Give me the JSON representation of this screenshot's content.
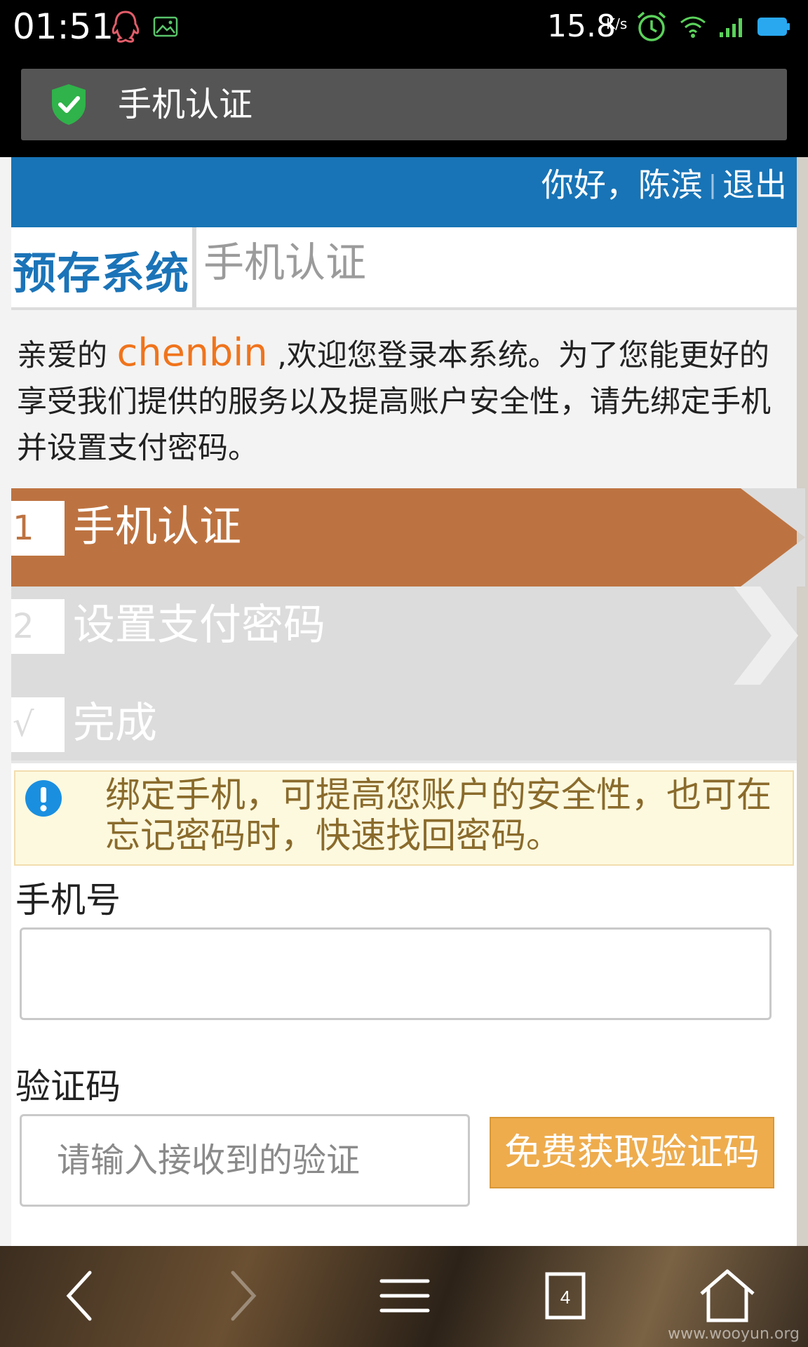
{
  "status_bar": {
    "time": "01:51",
    "net_speed": "15.8",
    "net_speed_unit": "K/s"
  },
  "title_bar": {
    "title": "手机认证"
  },
  "header": {
    "greeting": "你好，陈滨",
    "separator": "|",
    "logout": "退出"
  },
  "brand": {
    "name": "预存系统",
    "subtitle": "手机认证"
  },
  "welcome": {
    "prefix": "亲爱的 ",
    "username": "chenbin",
    "suffix": " ,欢迎您登录本系统。为了您能更好的享受我们提供的服务以及提高账户安全性，请先绑定手机并设置支付密码。"
  },
  "steps": [
    {
      "num": "1",
      "label": "手机认证",
      "state": "active"
    },
    {
      "num": "2",
      "label": "设置支付密码",
      "state": "pending"
    },
    {
      "num": "√",
      "label": "完成",
      "state": "pending"
    }
  ],
  "notice": {
    "text": "绑定手机，可提高您账户的安全性，也可在忘记密码时，快速找回密码。"
  },
  "form": {
    "phone_label": "手机号",
    "phone_value": "",
    "code_label": "验证码",
    "code_placeholder": "请输入接收到的验证",
    "get_code_button": "免费获取验证码"
  },
  "nav_bar": {
    "tab_count": "4",
    "watermark": "www.wooyun.org"
  },
  "colors": {
    "header_blue": "#1874b6",
    "active_step": "#bd7341",
    "username_orange": "#f0741c",
    "button_orange": "#eeac4d",
    "notice_bg": "#fdf9df"
  }
}
